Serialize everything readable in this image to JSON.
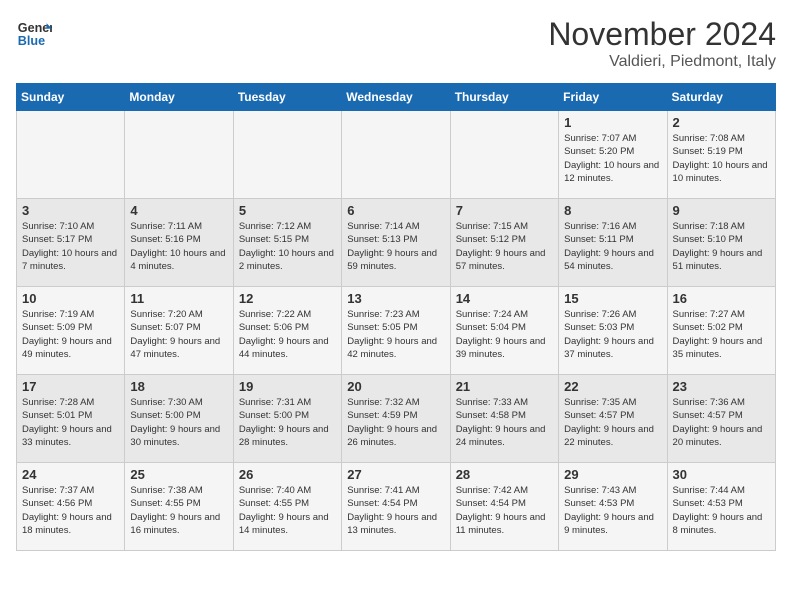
{
  "logo": {
    "line1": "General",
    "line2": "Blue"
  },
  "title": "November 2024",
  "subtitle": "Valdieri, Piedmont, Italy",
  "days_header": [
    "Sunday",
    "Monday",
    "Tuesday",
    "Wednesday",
    "Thursday",
    "Friday",
    "Saturday"
  ],
  "weeks": [
    [
      {
        "day": "",
        "info": ""
      },
      {
        "day": "",
        "info": ""
      },
      {
        "day": "",
        "info": ""
      },
      {
        "day": "",
        "info": ""
      },
      {
        "day": "",
        "info": ""
      },
      {
        "day": "1",
        "info": "Sunrise: 7:07 AM\nSunset: 5:20 PM\nDaylight: 10 hours and 12 minutes."
      },
      {
        "day": "2",
        "info": "Sunrise: 7:08 AM\nSunset: 5:19 PM\nDaylight: 10 hours and 10 minutes."
      }
    ],
    [
      {
        "day": "3",
        "info": "Sunrise: 7:10 AM\nSunset: 5:17 PM\nDaylight: 10 hours and 7 minutes."
      },
      {
        "day": "4",
        "info": "Sunrise: 7:11 AM\nSunset: 5:16 PM\nDaylight: 10 hours and 4 minutes."
      },
      {
        "day": "5",
        "info": "Sunrise: 7:12 AM\nSunset: 5:15 PM\nDaylight: 10 hours and 2 minutes."
      },
      {
        "day": "6",
        "info": "Sunrise: 7:14 AM\nSunset: 5:13 PM\nDaylight: 9 hours and 59 minutes."
      },
      {
        "day": "7",
        "info": "Sunrise: 7:15 AM\nSunset: 5:12 PM\nDaylight: 9 hours and 57 minutes."
      },
      {
        "day": "8",
        "info": "Sunrise: 7:16 AM\nSunset: 5:11 PM\nDaylight: 9 hours and 54 minutes."
      },
      {
        "day": "9",
        "info": "Sunrise: 7:18 AM\nSunset: 5:10 PM\nDaylight: 9 hours and 51 minutes."
      }
    ],
    [
      {
        "day": "10",
        "info": "Sunrise: 7:19 AM\nSunset: 5:09 PM\nDaylight: 9 hours and 49 minutes."
      },
      {
        "day": "11",
        "info": "Sunrise: 7:20 AM\nSunset: 5:07 PM\nDaylight: 9 hours and 47 minutes."
      },
      {
        "day": "12",
        "info": "Sunrise: 7:22 AM\nSunset: 5:06 PM\nDaylight: 9 hours and 44 minutes."
      },
      {
        "day": "13",
        "info": "Sunrise: 7:23 AM\nSunset: 5:05 PM\nDaylight: 9 hours and 42 minutes."
      },
      {
        "day": "14",
        "info": "Sunrise: 7:24 AM\nSunset: 5:04 PM\nDaylight: 9 hours and 39 minutes."
      },
      {
        "day": "15",
        "info": "Sunrise: 7:26 AM\nSunset: 5:03 PM\nDaylight: 9 hours and 37 minutes."
      },
      {
        "day": "16",
        "info": "Sunrise: 7:27 AM\nSunset: 5:02 PM\nDaylight: 9 hours and 35 minutes."
      }
    ],
    [
      {
        "day": "17",
        "info": "Sunrise: 7:28 AM\nSunset: 5:01 PM\nDaylight: 9 hours and 33 minutes."
      },
      {
        "day": "18",
        "info": "Sunrise: 7:30 AM\nSunset: 5:00 PM\nDaylight: 9 hours and 30 minutes."
      },
      {
        "day": "19",
        "info": "Sunrise: 7:31 AM\nSunset: 5:00 PM\nDaylight: 9 hours and 28 minutes."
      },
      {
        "day": "20",
        "info": "Sunrise: 7:32 AM\nSunset: 4:59 PM\nDaylight: 9 hours and 26 minutes."
      },
      {
        "day": "21",
        "info": "Sunrise: 7:33 AM\nSunset: 4:58 PM\nDaylight: 9 hours and 24 minutes."
      },
      {
        "day": "22",
        "info": "Sunrise: 7:35 AM\nSunset: 4:57 PM\nDaylight: 9 hours and 22 minutes."
      },
      {
        "day": "23",
        "info": "Sunrise: 7:36 AM\nSunset: 4:57 PM\nDaylight: 9 hours and 20 minutes."
      }
    ],
    [
      {
        "day": "24",
        "info": "Sunrise: 7:37 AM\nSunset: 4:56 PM\nDaylight: 9 hours and 18 minutes."
      },
      {
        "day": "25",
        "info": "Sunrise: 7:38 AM\nSunset: 4:55 PM\nDaylight: 9 hours and 16 minutes."
      },
      {
        "day": "26",
        "info": "Sunrise: 7:40 AM\nSunset: 4:55 PM\nDaylight: 9 hours and 14 minutes."
      },
      {
        "day": "27",
        "info": "Sunrise: 7:41 AM\nSunset: 4:54 PM\nDaylight: 9 hours and 13 minutes."
      },
      {
        "day": "28",
        "info": "Sunrise: 7:42 AM\nSunset: 4:54 PM\nDaylight: 9 hours and 11 minutes."
      },
      {
        "day": "29",
        "info": "Sunrise: 7:43 AM\nSunset: 4:53 PM\nDaylight: 9 hours and 9 minutes."
      },
      {
        "day": "30",
        "info": "Sunrise: 7:44 AM\nSunset: 4:53 PM\nDaylight: 9 hours and 8 minutes."
      }
    ]
  ]
}
